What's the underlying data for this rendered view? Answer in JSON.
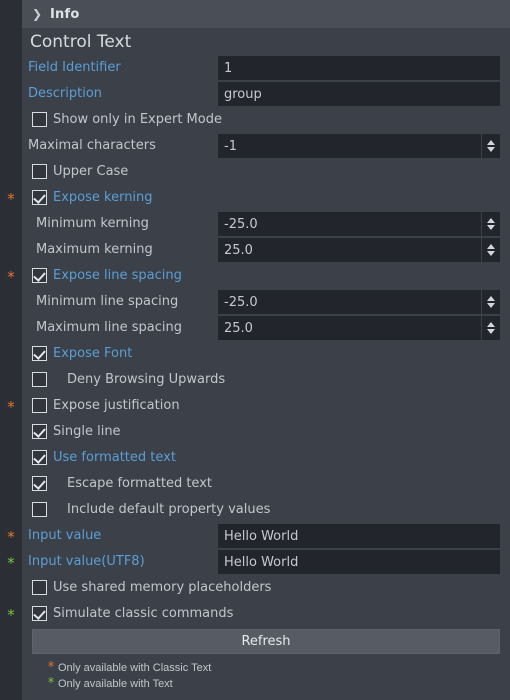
{
  "header": {
    "chevron_icon": "chevron-right-icon",
    "title": "Info"
  },
  "section": {
    "title": "Control Text"
  },
  "colors": {
    "panel_bg": "#3c4049",
    "gutter_bg": "#2b2e35",
    "header_bg": "#4a4e57",
    "field_bg": "#22252b",
    "link_text": "#5a9fd4",
    "plain_text": "#c2c6cc",
    "star_classic": "#e8762c",
    "star_text": "#78c63c",
    "button_bg": "#565b64"
  },
  "rows": [
    {
      "id": "field-identifier",
      "kind": "text",
      "label": "Field Identifier",
      "label_style": "link",
      "value": "1",
      "marker": ""
    },
    {
      "id": "description",
      "kind": "text",
      "label": "Description",
      "label_style": "link",
      "value": "group",
      "marker": ""
    },
    {
      "id": "show-only-expert-mode",
      "kind": "check",
      "label": "Show only in Expert Mode",
      "label_style": "plain",
      "checked": false,
      "indent": 0,
      "marker": ""
    },
    {
      "id": "maximal-characters",
      "kind": "spin",
      "label": "Maximal characters",
      "label_style": "plain",
      "value": "-1",
      "marker": ""
    },
    {
      "id": "upper-case",
      "kind": "check",
      "label": "Upper Case",
      "label_style": "plain",
      "checked": false,
      "indent": 0,
      "marker": ""
    },
    {
      "id": "expose-kerning",
      "kind": "check",
      "label": "Expose kerning",
      "label_style": "link",
      "checked": true,
      "indent": 0,
      "marker": "classic"
    },
    {
      "id": "minimum-kerning",
      "kind": "spin",
      "label": "Minimum kerning",
      "label_style": "plain",
      "value": "-25.0",
      "marker": "",
      "indent": 1
    },
    {
      "id": "maximum-kerning",
      "kind": "spin",
      "label": "Maximum kerning",
      "label_style": "plain",
      "value": "25.0",
      "marker": "",
      "indent": 1
    },
    {
      "id": "expose-line-spacing",
      "kind": "check",
      "label": "Expose line spacing",
      "label_style": "link",
      "checked": true,
      "indent": 0,
      "marker": "classic"
    },
    {
      "id": "minimum-line-spacing",
      "kind": "spin",
      "label": "Minimum line spacing",
      "label_style": "plain",
      "value": "-25.0",
      "marker": "",
      "indent": 1
    },
    {
      "id": "maximum-line-spacing",
      "kind": "spin",
      "label": "Maximum line spacing",
      "label_style": "plain",
      "value": "25.0",
      "marker": "",
      "indent": 1
    },
    {
      "id": "expose-font",
      "kind": "check",
      "label": "Expose Font",
      "label_style": "link",
      "checked": true,
      "indent": 0,
      "marker": ""
    },
    {
      "id": "deny-browsing-upwards",
      "kind": "check",
      "label": "Deny Browsing Upwards",
      "label_style": "plain",
      "checked": false,
      "indent": 1,
      "marker": ""
    },
    {
      "id": "expose-justification",
      "kind": "check",
      "label": "Expose justification",
      "label_style": "plain",
      "checked": false,
      "indent": 0,
      "marker": "classic"
    },
    {
      "id": "single-line",
      "kind": "check",
      "label": "Single line",
      "label_style": "plain",
      "checked": true,
      "indent": 0,
      "marker": ""
    },
    {
      "id": "use-formatted-text",
      "kind": "check",
      "label": "Use formatted text",
      "label_style": "link",
      "checked": true,
      "indent": 0,
      "marker": ""
    },
    {
      "id": "escape-formatted-text",
      "kind": "check",
      "label": "Escape formatted text",
      "label_style": "plain",
      "checked": true,
      "indent": 1,
      "marker": ""
    },
    {
      "id": "include-default-property-values",
      "kind": "check",
      "label": "Include default property values",
      "label_style": "plain",
      "checked": false,
      "indent": 1,
      "marker": ""
    },
    {
      "id": "input-value",
      "kind": "text",
      "label": "Input value",
      "label_style": "link",
      "value": "Hello World",
      "marker": "classic"
    },
    {
      "id": "input-value-utf8",
      "kind": "text",
      "label": "Input value(UTF8)",
      "label_style": "link",
      "value": "Hello World",
      "marker": "text"
    },
    {
      "id": "use-shared-memory-placeholders",
      "kind": "check",
      "label": "Use shared memory placeholders",
      "label_style": "plain",
      "checked": false,
      "indent": 0,
      "marker": ""
    },
    {
      "id": "simulate-classic-commands",
      "kind": "check",
      "label": "Simulate classic commands",
      "label_style": "plain",
      "checked": true,
      "indent": 0,
      "marker": "text"
    }
  ],
  "refresh_button": {
    "label": "Refresh"
  },
  "legend": [
    {
      "star": "*",
      "kind": "classic",
      "text": "Only available with Classic Text"
    },
    {
      "star": "*",
      "kind": "text",
      "text": "Only available with Text"
    }
  ]
}
